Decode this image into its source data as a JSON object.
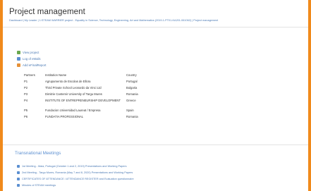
{
  "page": {
    "title": "Project management",
    "breadcrumb": "Dashboard | My Leader | 1:STEAM WARRIER project - Equality in Science, Technology, Engineering, Art and Mathematics (2019-1-PT01-KA201-061062) | Project management"
  },
  "links": [
    {
      "label": "View project",
      "icon": "green-doc-icon"
    },
    {
      "label": "Log of eMails",
      "icon": "blue-doc-icon"
    },
    {
      "label": "Add eFinalReport",
      "icon": "orange-doc-icon"
    }
  ],
  "partners_table": {
    "headers": [
      "Partners",
      "Institution Name",
      "Country"
    ],
    "rows": [
      {
        "role": "P1",
        "name": "Agrupamento de Escolas de Ellora",
        "country": "Portugal"
      },
      {
        "role": "P2",
        "name": "Third Private School Leonardo da Vinci Ltd",
        "country": "Bulgaria"
      },
      {
        "role": "P3",
        "name": "Dimitrie Cantemir University of Targu Mures",
        "country": "Romania"
      },
      {
        "role": "P4",
        "name": "INSTITUTE OF ENTREPRENEURSHIP DEVELOPMENT",
        "country": "Greece"
      },
      {
        "role": "P5",
        "name": "Fundacion Universidad Laureat / Empresa",
        "country": "Spain"
      },
      {
        "role": "P6",
        "name": "FUNDATIA PROFESSIONAL",
        "country": "Romania"
      }
    ]
  },
  "meetings": {
    "title": "Transnational Meetings",
    "items": [
      "1st Meeting - Maia, Portugal (October 1 and 2, 2019) Presentations and Working Papers",
      "2nd Meeting - Targu Mures, Romania (May 7 and 8, 2020) Presentations and Working Papers",
      "CERTIFICATES OF ATTENDANCE / ATTENDANCE REGISTER and Evaluation questionnaire",
      "Minutes of STEAM meetings"
    ]
  },
  "colors": {
    "frame": "#f08a1c",
    "link": "#4a79b4",
    "section": "#5b8fd1"
  }
}
